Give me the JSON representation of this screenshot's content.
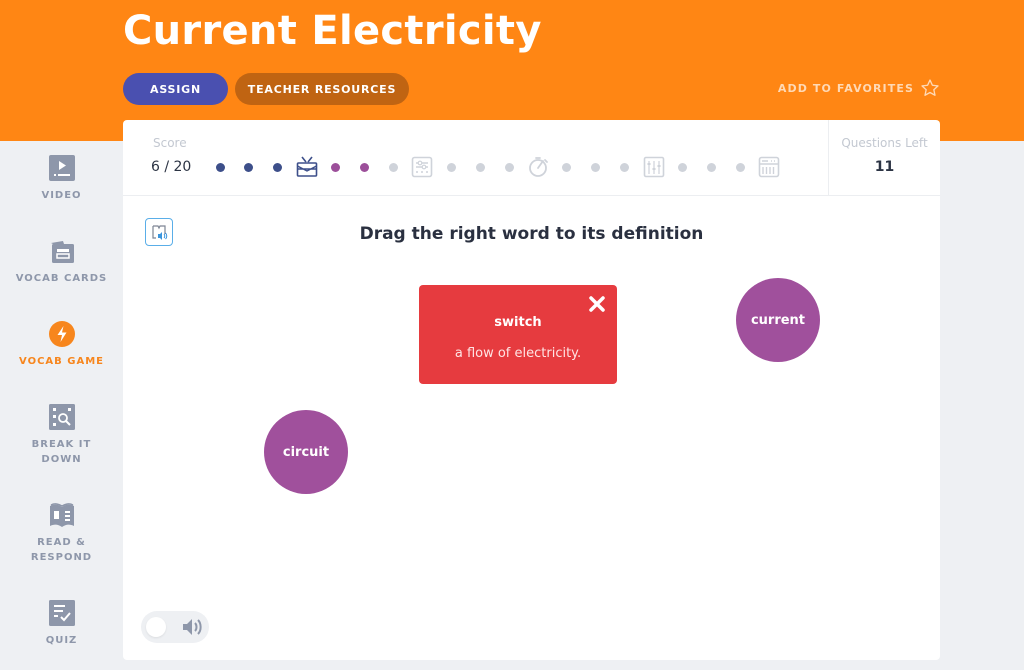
{
  "header": {
    "title": "Current Electricity",
    "assign_label": "ASSIGN",
    "teacher_resources_label": "TEACHER RESOURCES",
    "favorites_label": "ADD TO FAVORITES",
    "colors": {
      "header_bg": "#ff8614",
      "assign_bg": "#4a50b0",
      "teacher_bg": "#c06412"
    }
  },
  "sidebar": {
    "items": [
      {
        "label": "VIDEO",
        "icon": "video-icon",
        "active": false
      },
      {
        "label": "VOCAB CARDS",
        "icon": "vocab-cards-icon",
        "active": false
      },
      {
        "label": "VOCAB GAME",
        "icon": "lightning-icon",
        "active": true
      },
      {
        "label": "BREAK IT\nDOWN",
        "label_lines": [
          "BREAK IT",
          "DOWN"
        ],
        "icon": "break-it-down-icon",
        "active": false
      },
      {
        "label": "READ &\nRESPOND",
        "label_lines": [
          "READ &",
          "RESPOND"
        ],
        "icon": "book-icon",
        "active": false
      },
      {
        "label": "QUIZ",
        "icon": "quiz-icon",
        "active": false
      }
    ],
    "active_color": "#f7861d"
  },
  "game": {
    "score_label": "Score",
    "score_value": "6 / 20",
    "score_numeric": {
      "current": 6,
      "total": 20
    },
    "questions_left_label": "Questions Left",
    "questions_left_value": "11",
    "progress_track": [
      {
        "type": "dot",
        "state": "correct"
      },
      {
        "type": "dot",
        "state": "correct"
      },
      {
        "type": "dot",
        "state": "correct"
      },
      {
        "type": "icon",
        "icon": "drum-icon",
        "state": "reached"
      },
      {
        "type": "dot",
        "state": "answered"
      },
      {
        "type": "dot",
        "state": "answered"
      },
      {
        "type": "dot",
        "state": "pending"
      },
      {
        "type": "icon",
        "icon": "mixer-icon",
        "state": "pending"
      },
      {
        "type": "dot",
        "state": "pending"
      },
      {
        "type": "dot",
        "state": "pending"
      },
      {
        "type": "dot",
        "state": "pending"
      },
      {
        "type": "icon",
        "icon": "stopwatch-icon",
        "state": "pending"
      },
      {
        "type": "dot",
        "state": "pending"
      },
      {
        "type": "dot",
        "state": "pending"
      },
      {
        "type": "dot",
        "state": "pending"
      },
      {
        "type": "icon",
        "icon": "equalizer-icon",
        "state": "pending"
      },
      {
        "type": "dot",
        "state": "pending"
      },
      {
        "type": "dot",
        "state": "pending"
      },
      {
        "type": "dot",
        "state": "pending"
      },
      {
        "type": "icon",
        "icon": "keyboard-icon",
        "state": "pending"
      }
    ],
    "track_colors": {
      "correct": "#3d4f8a",
      "reached": "#3d4f8a",
      "answered": "#9c4f9a",
      "pending": "#cfd3da"
    },
    "instruction": "Drag the right word to its definition",
    "definition_card": {
      "word": "switch",
      "definition": "a flow of electricity.",
      "state": "incorrect",
      "color": "#e63b3f"
    },
    "word_bubbles": [
      {
        "word": "current"
      },
      {
        "word": "circuit"
      }
    ],
    "bubble_color": "#a0509c",
    "sound_toggle": {
      "on": false
    }
  }
}
